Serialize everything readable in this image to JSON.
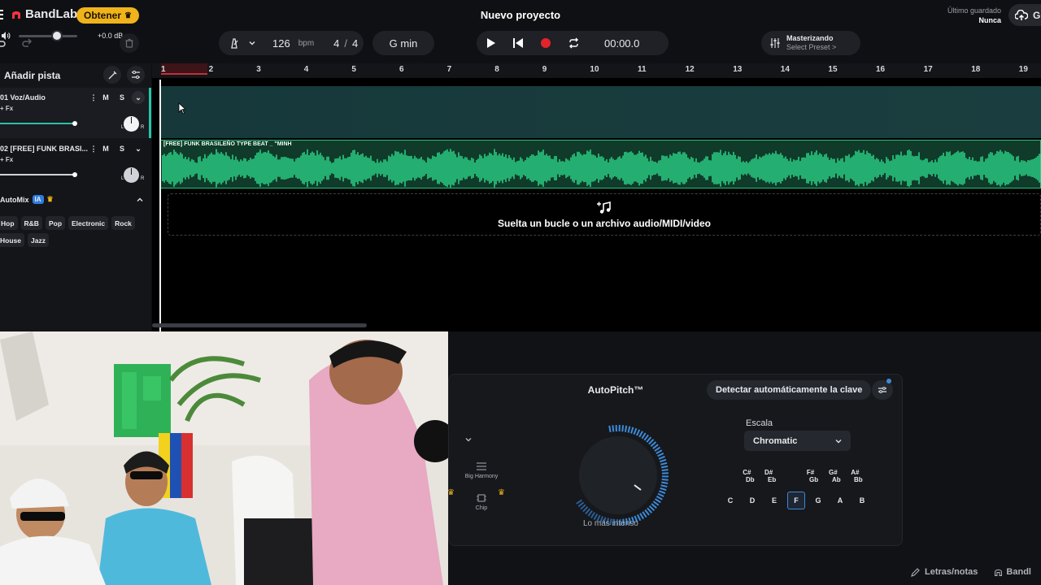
{
  "topbar": {
    "brand": "BandLab",
    "get_label": "Obtener",
    "project_title": "Nuevo proyecto",
    "saved_label": "Último guardado",
    "saved_value": "Nunca",
    "cloud_label": "Gu"
  },
  "transport": {
    "tempo": "126",
    "tempo_unit": "bpm",
    "time_sig_top": "4",
    "time_sig_sep": "/",
    "time_sig_bottom": "4",
    "key": "G min",
    "time": "00:00.0",
    "mastering_title": "Masterizando",
    "mastering_sub": "Select Preset >",
    "volume_db": "+0.0 dB",
    "volume_level": 0.65
  },
  "sidebar": {
    "add_track": "Añadir pista",
    "tracks": [
      {
        "name": "01  Voz/Audio",
        "fx": "+ Fx",
        "mute": "M",
        "solo": "S"
      },
      {
        "name": "02  [FREE] FUNK BRASI...",
        "fx": "+ Fx",
        "mute": "M",
        "solo": "S"
      }
    ],
    "automix": {
      "title": "AutoMix",
      "ai_badge": "IA",
      "genres_row1": [
        "Hop",
        "R&B",
        "Pop",
        "Electronic",
        "Rock"
      ],
      "genres_row2": [
        "House",
        "Jazz"
      ]
    }
  },
  "timeline": {
    "ruler": [
      "1",
      "2",
      "3",
      "4",
      "5",
      "6",
      "7",
      "8",
      "9",
      "10",
      "11",
      "12",
      "13",
      "14",
      "15",
      "16",
      "17",
      "18",
      "19"
    ],
    "clip_label": "[FREE] FUNK BRASILEÑO TYPE BEAT _ \"MINH",
    "drop_text": "Suelta un bucle o un archivo audio/MIDI/video"
  },
  "autopitch": {
    "title": "AutoPitch™",
    "detect_label": "Detectar automáticamente la clave",
    "scale_label": "Escala",
    "scale_value": "Chromatic",
    "intensity_label": "Lo más intenso",
    "effects": [
      "Big Harmony",
      "Chip"
    ],
    "sharps": [
      {
        "top": "C#",
        "bottom": "Db"
      },
      {
        "top": "D#",
        "bottom": "Eb"
      },
      {
        "top": "F#",
        "bottom": "Gb"
      },
      {
        "top": "G#",
        "bottom": "Ab"
      },
      {
        "top": "A#",
        "bottom": "Bb"
      }
    ],
    "naturals": [
      "C",
      "D",
      "E",
      "F",
      "G",
      "A",
      "B"
    ],
    "selected_note": "F"
  },
  "bottombar": {
    "lyrics": "Letras/notas",
    "bandlab": "Bandl"
  },
  "colors": {
    "accent_teal": "#22c7a8",
    "clip_green": "#1ec47b",
    "record_red": "#e5232a",
    "get_gold": "#f0b31b",
    "autopitch_blue": "#3d8bd9"
  }
}
